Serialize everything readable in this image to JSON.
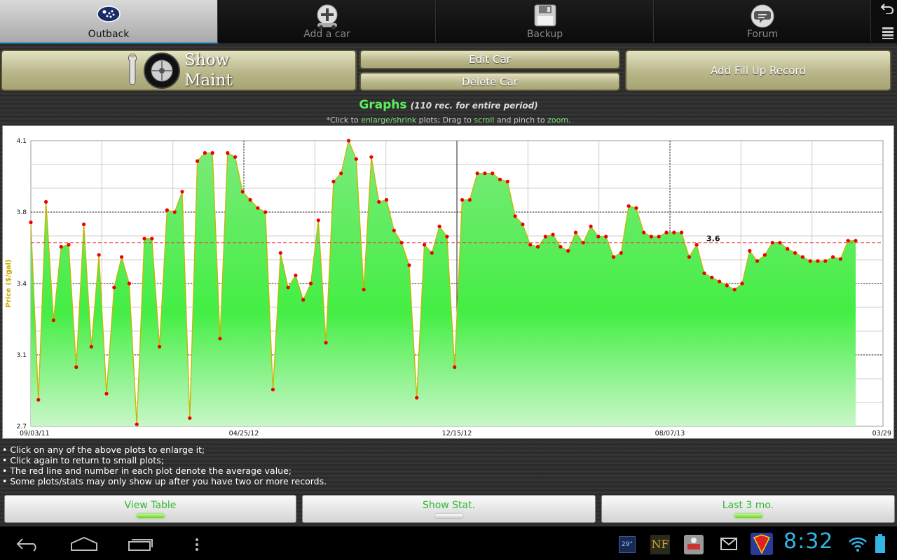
{
  "tabs": [
    {
      "label": "Outback",
      "icon": "subaru-logo-icon",
      "active": true
    },
    {
      "label": "Add a car",
      "icon": "add-car-icon",
      "active": false
    },
    {
      "label": "Backup",
      "icon": "floppy-disk-icon",
      "active": false
    },
    {
      "label": "Forum",
      "icon": "forum-chat-icon",
      "active": false
    }
  ],
  "actions": {
    "show_maint": "Show\nMaint",
    "edit_car": "Edit Car",
    "delete_car": "Delete Car",
    "add_fill_up": "Add Fill Up Record"
  },
  "graph": {
    "title": "Graphs",
    "subtitle": "(110 rec. for entire period)",
    "hint_prefix": "*Click to ",
    "hint_link1": "enlarge/shrink",
    "hint_mid1": " plots; Drag to ",
    "hint_link2": "scroll",
    "hint_mid2": " and pinch to ",
    "hint_link3": "zoom",
    "hint_end": "."
  },
  "chart_data": {
    "type": "area",
    "ylabel": "Price ($/gal)",
    "ylim": [
      2.7,
      4.1
    ],
    "yticks": [
      4.1,
      3.8,
      3.4,
      3.1,
      2.7
    ],
    "xtick_labels": [
      "09/03/11",
      "04/25/12",
      "12/15/12",
      "08/07/13",
      "03/29"
    ],
    "average": 3.6,
    "average_label": "3.6",
    "grid": true,
    "colors": {
      "fill": "#44ee44",
      "line": "#c8b400",
      "point": "#ee0000",
      "avg": "#ee4444"
    },
    "values": [
      3.7,
      2.83,
      3.8,
      3.22,
      3.58,
      3.59,
      2.99,
      3.69,
      3.09,
      3.54,
      2.86,
      3.38,
      3.53,
      3.4,
      2.71,
      3.62,
      3.62,
      3.09,
      3.76,
      3.75,
      3.85,
      2.74,
      4.0,
      4.04,
      4.04,
      3.13,
      4.04,
      4.02,
      3.85,
      3.81,
      3.77,
      3.75,
      2.88,
      3.55,
      3.38,
      3.44,
      3.32,
      3.4,
      3.71,
      3.11,
      3.9,
      3.94,
      4.1,
      4.01,
      3.37,
      4.02,
      3.8,
      3.81,
      3.66,
      3.6,
      3.49,
      2.84,
      3.59,
      3.55,
      3.68,
      3.63,
      2.99,
      3.81,
      3.81,
      3.94,
      3.94,
      3.94,
      3.91,
      3.9,
      3.73,
      3.69,
      3.59,
      3.58,
      3.63,
      3.64,
      3.58,
      3.56,
      3.65,
      3.6,
      3.68,
      3.63,
      3.63,
      3.53,
      3.55,
      3.78,
      3.77,
      3.65,
      3.63,
      3.63,
      3.65,
      3.65,
      3.65,
      3.53,
      3.59,
      3.45,
      3.43,
      3.41,
      3.39,
      3.37,
      3.4,
      3.56,
      3.51,
      3.54,
      3.6,
      3.6,
      3.57,
      3.55,
      3.53,
      3.51,
      3.51,
      3.51,
      3.53,
      3.52,
      3.61,
      3.61
    ]
  },
  "notes": [
    "Click on any of the above plots to enlarge it;",
    "Click again to return to small plots;",
    "The red line and number in each plot denote the average value;",
    "Some plots/stats may only show up after you have two or more records."
  ],
  "bottom_buttons": [
    {
      "label": "View Table",
      "led": "on"
    },
    {
      "label": "Show Stat.",
      "led": "off"
    },
    {
      "label": "Last 3 mo.",
      "led": "on"
    }
  ],
  "status": {
    "time": "8:32",
    "weather": "29°",
    "nf_label": "NF"
  }
}
